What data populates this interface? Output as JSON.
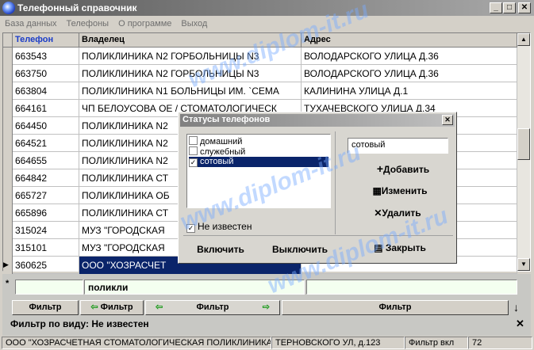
{
  "window": {
    "title": "Телефонный справочник"
  },
  "menu": [
    "База данных",
    "Телефоны",
    "О программе",
    "Выход"
  ],
  "grid": {
    "headers": [
      "Телефон",
      "Владелец",
      "Адрес"
    ],
    "rows": [
      {
        "phone": "663543",
        "owner": "ПОЛИКЛИНИКА N2 ГОРБОЛЬНИЦЫ N3",
        "address": "ВОЛОДАРСКОГО УЛИЦА Д.36"
      },
      {
        "phone": "663750",
        "owner": "ПОЛИКЛИНИКА N2 ГОРБОЛЬНИЦЫ N3",
        "address": "ВОЛОДАРСКОГО УЛИЦА Д.36"
      },
      {
        "phone": "663804",
        "owner": "ПОЛИКЛИНИКА N1 БОЛЬНИЦЫ ИМ. `СЕМА",
        "address": "КАЛИНИНА УЛИЦА Д.1"
      },
      {
        "phone": "664161",
        "owner": "ЧП БЕЛОУСОВА ОЕ / СТОМАТОЛОГИЧЕСК",
        "address": "ТУХАЧЕВСКОГО УЛИЦА Д.34"
      },
      {
        "phone": "664450",
        "owner": "ПОЛИКЛИНИКА N2",
        "address": ""
      },
      {
        "phone": "664521",
        "owner": "ПОЛИКЛИНИКА N2",
        "address": ""
      },
      {
        "phone": "664655",
        "owner": "ПОЛИКЛИНИКА N2",
        "address": ""
      },
      {
        "phone": "664842",
        "owner": "ПОЛИКЛИНИКА СТ",
        "address": ""
      },
      {
        "phone": "665727",
        "owner": "ПОЛИКЛИНИКА ОБ",
        "address": ""
      },
      {
        "phone": "665896",
        "owner": "ПОЛИКЛИНИКА СТ",
        "address": ""
      },
      {
        "phone": "315024",
        "owner": " МУЗ \"ГОРОДСКАЯ",
        "address": ""
      },
      {
        "phone": "315101",
        "owner": " МУЗ \"ГОРОДСКАЯ",
        "address": ""
      },
      {
        "phone": "360625",
        "owner": "ООО \"ХОЗРАСЧЕТ",
        "address": ""
      }
    ]
  },
  "filters": {
    "input1": "",
    "input2": "поликли",
    "input3": "",
    "btn1": "Фильтр",
    "btn2": "Фильтр",
    "btn3": "Фильтр",
    "btn4": "Фильтр",
    "by_type_label": "Фильтр по виду:",
    "by_type_value": "Не известен"
  },
  "status": {
    "owner": "ООО \"ХОЗРАСЧЕТНАЯ СТОМАТОЛОГИЧЕСКАЯ ПОЛИКЛИНИКА\"",
    "address": "ТЕРНОВСКОГО УЛ, д.123",
    "filter": "Фильтр вкл",
    "count": "72"
  },
  "dialog": {
    "title": "Статусы телефонов",
    "items": [
      {
        "label": "домашний",
        "checked": false
      },
      {
        "label": "служебный",
        "checked": false
      },
      {
        "label": "сотовый",
        "checked": true
      }
    ],
    "unknown_label": "Не известен",
    "unknown_checked": true,
    "edit_value": "сотовый",
    "add": "Добавить",
    "edit": "Изменить",
    "delete": "Удалить",
    "enable": "Включить",
    "disable": "Выключить",
    "close": "Закрыть"
  },
  "watermark": "www.diplom-it.ru"
}
